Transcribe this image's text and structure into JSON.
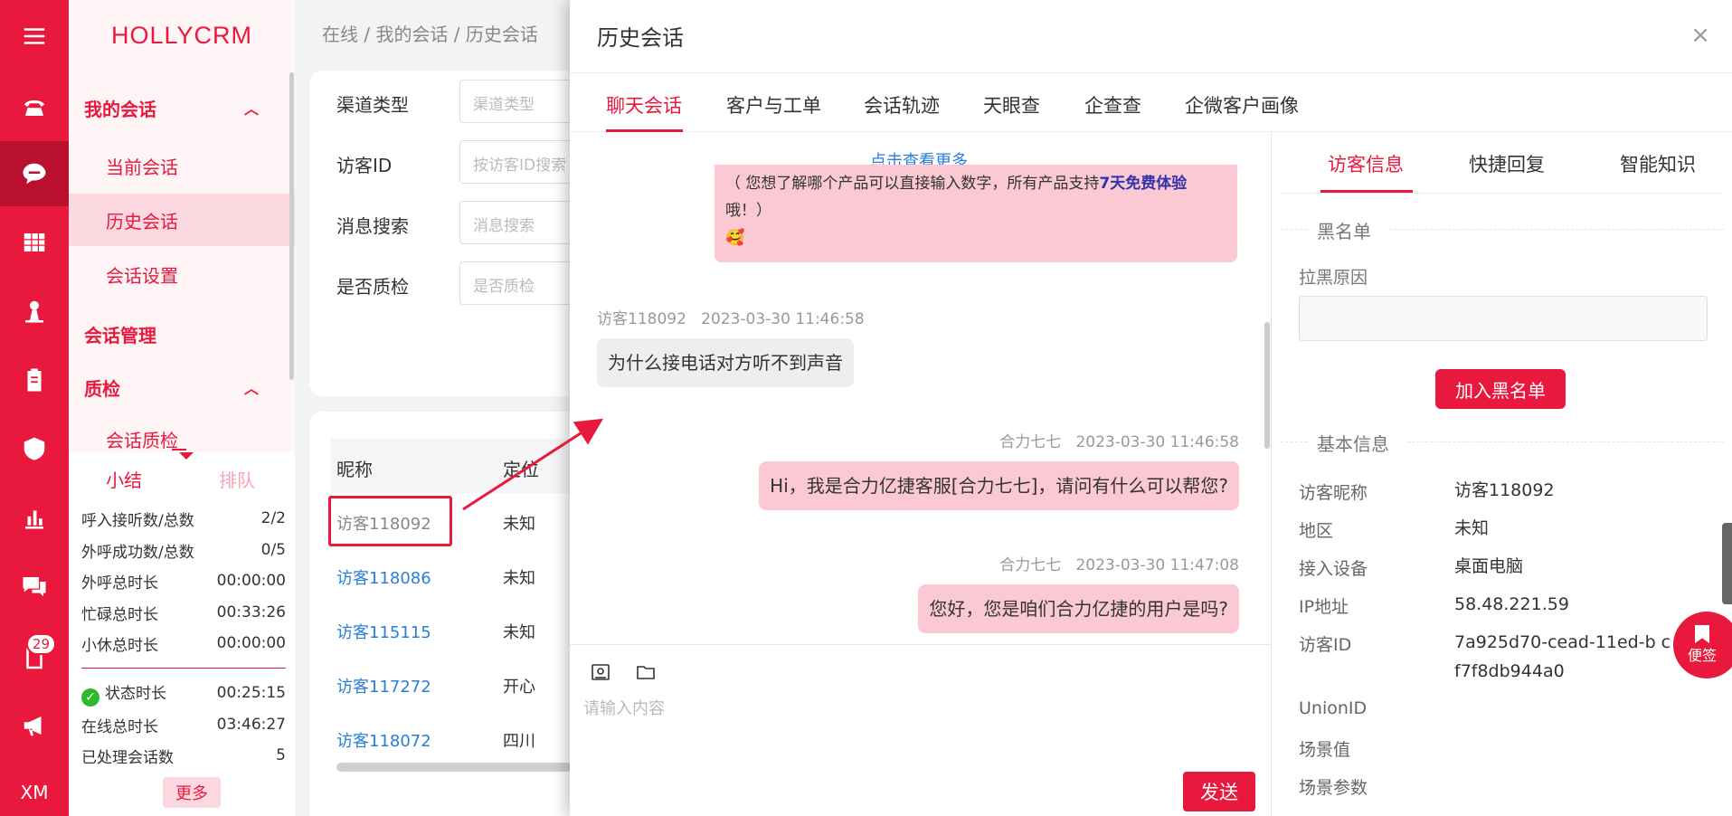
{
  "brand": "HOLLYCRM",
  "rail": {
    "badge_count": "29",
    "bottom_label": "XM"
  },
  "sidebar": {
    "groups": [
      {
        "label": "我的会话"
      },
      {
        "label": "会话管理"
      },
      {
        "label": "质检"
      }
    ],
    "items": [
      {
        "label": "当前会话"
      },
      {
        "label": "历史会话"
      },
      {
        "label": "会话设置"
      },
      {
        "label": "会话质检"
      }
    ]
  },
  "stats": {
    "tab_summary": "小结",
    "tab_queue": "排队",
    "rows": [
      {
        "label": "呼入接听数/总数",
        "value": "2/2"
      },
      {
        "label": "外呼成功数/总数",
        "value": "0/5"
      },
      {
        "label": "外呼总时长",
        "value": "00:00:00"
      },
      {
        "label": "忙碌总时长",
        "value": "00:33:26"
      },
      {
        "label": "小休总时长",
        "value": "00:00:00"
      },
      {
        "label": "状态时长",
        "value": "00:25:15"
      },
      {
        "label": "在线总时长",
        "value": "03:46:27"
      },
      {
        "label": "已处理会话数",
        "value": "5"
      }
    ],
    "more": "更多"
  },
  "breadcrumb": "在线  /  我的会话  /  历史会话",
  "filters": [
    {
      "label": "渠道类型",
      "placeholder": "渠道类型"
    },
    {
      "label": "访客ID",
      "placeholder": "按访客ID搜索"
    },
    {
      "label": "消息搜索",
      "placeholder": "消息搜索"
    },
    {
      "label": "是否质检",
      "placeholder": "是否质检"
    }
  ],
  "table": {
    "headers": [
      "昵称",
      "定位"
    ],
    "rows": [
      {
        "nick": "访客118092",
        "loc": "未知"
      },
      {
        "nick": "访客118086",
        "loc": "未知"
      },
      {
        "nick": "访客115115",
        "loc": "未知"
      },
      {
        "nick": "访客117272",
        "loc": "开心"
      },
      {
        "nick": "访客118072",
        "loc": "四川"
      }
    ]
  },
  "drawer": {
    "title": "历史会话",
    "close": "×",
    "tabs": [
      "聊天会话",
      "客户与工单",
      "会话轨迹",
      "天眼查",
      "企查查",
      "企微客户画像"
    ],
    "see_more": "点击查看更多",
    "msg0_line1": "（ 您想了解哪个产品可以直接输入数字，所有产品支持",
    "msg0_emph": "7天免费体验",
    "msg0_line2": "哦！）",
    "msg0_emoji": "🥰",
    "messages": [
      {
        "sender": "访客118092",
        "time": "2023-03-30 11:46:58",
        "text": "为什么接电话对方听不到声音"
      },
      {
        "sender": "合力七七",
        "time": "2023-03-30 11:46:58",
        "text": "Hi，我是合力亿捷客服[合力七七]，请问有什么可以帮您?"
      },
      {
        "sender": "合力七七",
        "time": "2023-03-30 11:47:08",
        "text": "您好，您是咱们合力亿捷的用户是吗?"
      }
    ],
    "composer_placeholder": "请输入内容",
    "send": "发送"
  },
  "right_panel": {
    "tabs": [
      "访客信息",
      "快捷回复",
      "智能知识"
    ],
    "blacklist_title": "黑名单",
    "reason_label": "拉黑原因",
    "add_blacklist": "加入黑名单",
    "basic_title": "基本信息",
    "fields": [
      {
        "label": "访客昵称",
        "value": "访客118092"
      },
      {
        "label": "地区",
        "value": "未知"
      },
      {
        "label": "接入设备",
        "value": "桌面电脑"
      },
      {
        "label": "IP地址",
        "value": "58.48.221.59"
      },
      {
        "label": "访客ID",
        "value": "7a925d70-cead-11ed-b cf7f8db944a0"
      },
      {
        "label": "UnionID",
        "value": ""
      },
      {
        "label": "场景值",
        "value": ""
      },
      {
        "label": "场景参数",
        "value": ""
      }
    ]
  },
  "sticky_label": "便签",
  "colors": {
    "brand_red": "#e8193c",
    "link_blue": "#2a7ed8",
    "out_bubble": "#fbc9d3"
  }
}
